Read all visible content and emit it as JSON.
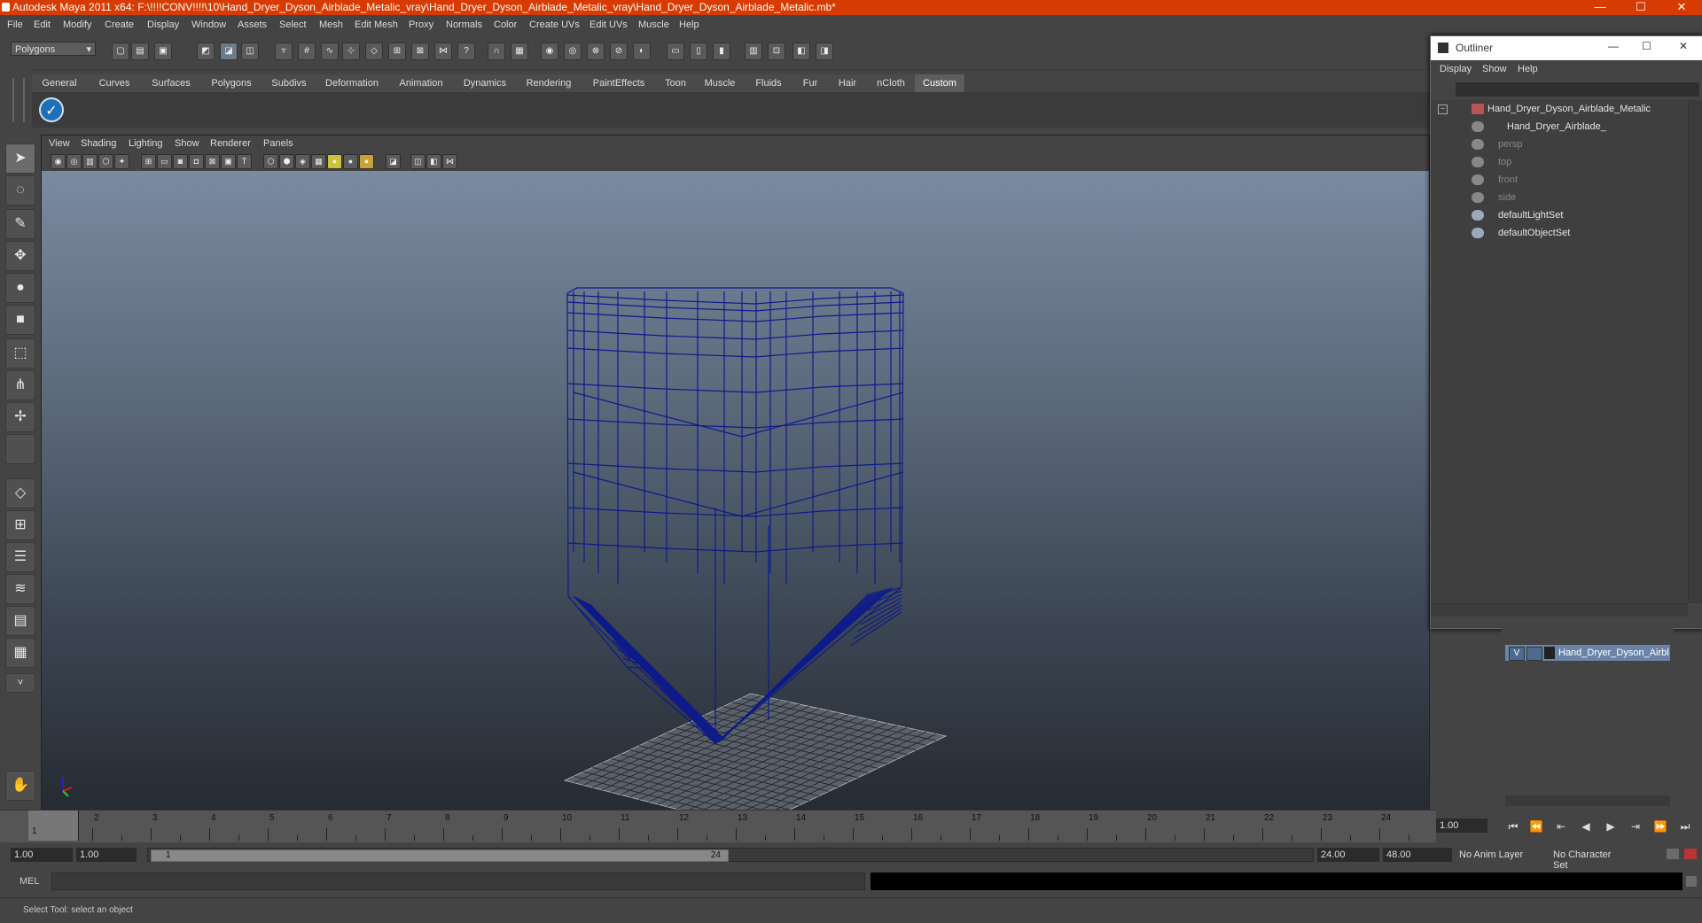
{
  "window": {
    "title": "Autodesk Maya 2011 x64: F:\\!!!!CONV!!!!\\10\\Hand_Dryer_Dyson_Airblade_Metalic_vray\\Hand_Dryer_Dyson_Airblade_Metalic_vray\\Hand_Dryer_Dyson_Airblade_Metalic.mb*",
    "minimize": "—",
    "maximize": "☐",
    "close": "✕"
  },
  "menubar": [
    "File",
    "Edit",
    "Modify",
    "Create",
    "Display",
    "Window",
    "Assets",
    "Select",
    "Mesh",
    "Edit Mesh",
    "Proxy",
    "Normals",
    "Color",
    "Create UVs",
    "Edit UVs",
    "Muscle",
    "Help"
  ],
  "status": {
    "mode": "Polygons"
  },
  "shelf": {
    "tabs": [
      "General",
      "Curves",
      "Surfaces",
      "Polygons",
      "Subdivs",
      "Deformation",
      "Animation",
      "Dynamics",
      "Rendering",
      "PaintEffects",
      "Toon",
      "Muscle",
      "Fluids",
      "Fur",
      "Hair",
      "nCloth",
      "Custom"
    ],
    "active": "Custom"
  },
  "viewport": {
    "menu": [
      "View",
      "Shading",
      "Lighting",
      "Show",
      "Renderer",
      "Panels"
    ]
  },
  "outliner": {
    "title": "Outliner",
    "menu": [
      "Display",
      "Show",
      "Help"
    ],
    "items": [
      {
        "name": "Hand_Dryer_Dyson_Airblade_Metalic",
        "dim": false
      },
      {
        "name": "Hand_Dryer_Airblade_",
        "dim": false
      },
      {
        "name": "persp",
        "dim": true
      },
      {
        "name": "top",
        "dim": true
      },
      {
        "name": "front",
        "dim": true
      },
      {
        "name": "side",
        "dim": true
      },
      {
        "name": "defaultLightSet",
        "dim": false
      },
      {
        "name": "defaultObjectSet",
        "dim": false
      }
    ]
  },
  "layers": {
    "row": {
      "visible": "V",
      "name": "Hand_Dryer_Dyson_Airbl"
    }
  },
  "timeline": {
    "ticks": [
      "1",
      "2",
      "3",
      "4",
      "5",
      "6",
      "7",
      "8",
      "9",
      "10",
      "11",
      "12",
      "13",
      "14",
      "15",
      "16",
      "17",
      "18",
      "19",
      "20",
      "21",
      "22",
      "23",
      "24"
    ],
    "current": "1",
    "current_frame": "1.00"
  },
  "range": {
    "start": "1.00",
    "playback_start": "1.00",
    "slider_start": "1",
    "slider_end": "24",
    "playback_end": "24.00",
    "end": "48.00",
    "anim_layer": "No Anim Layer",
    "char_set": "No Character Set"
  },
  "cmd": {
    "label": "MEL"
  },
  "help": {
    "text": "Select Tool: select an object"
  }
}
